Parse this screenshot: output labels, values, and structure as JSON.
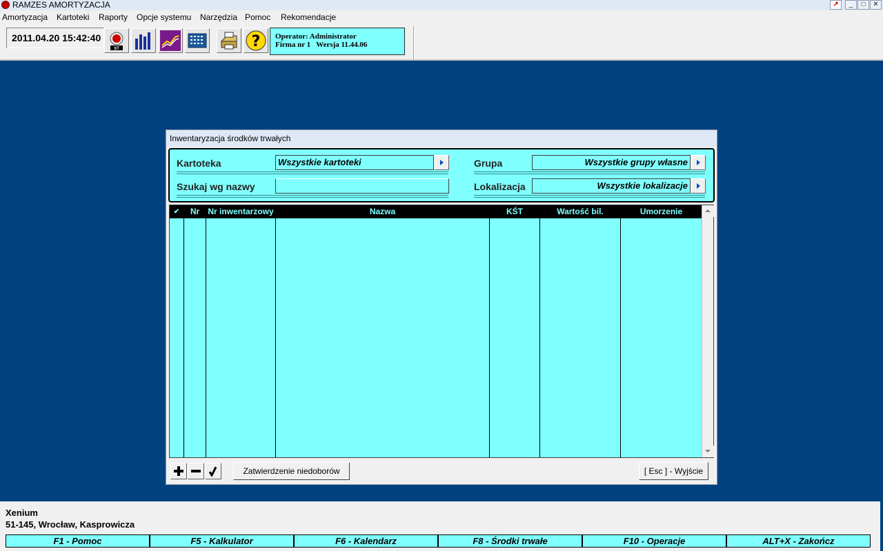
{
  "app": {
    "title": "RAMZES AMORTYZACJA"
  },
  "menu": [
    "Amortyzacja",
    "Kartoteki",
    "Raporty",
    "Opcje systemu",
    "Narzędzia",
    "Pomoc",
    "Rekomendacje"
  ],
  "toolbar": {
    "datetime": "2011.04.20 15:42:40",
    "operator_line1": "Operator: Administrator",
    "operator_line2": "Firma nr 1   Wersja 11.44.06",
    "st_label": "ST"
  },
  "dialog": {
    "title": "Inwentaryzacja środków trwałych",
    "filters": {
      "kartoteka_label": "Kartoteka",
      "kartoteka_value": "Wszystkie kartoteki",
      "szukaj_label": "Szukaj wg nazwy",
      "szukaj_value": "",
      "grupa_label": "Grupa",
      "grupa_value": "Wszystkie grupy własne",
      "lokalizacja_label": "Lokalizacja",
      "lokalizacja_value": "Wszystkie lokalizacje"
    },
    "grid": {
      "columns": [
        "✔",
        "Nr",
        "Nr inwentarzowy",
        "Nazwa",
        "KŚT",
        "Wartość bil.",
        "Umorzenie"
      ],
      "rows": []
    },
    "buttons": {
      "add": "+",
      "remove": "−",
      "confirm": "Zatwierdzenie niedoborów",
      "exit": "[ Esc ] - Wyjście"
    }
  },
  "footer": {
    "company_name": "Xenium",
    "company_address": "51-145, Wrocław, Kasprowicza",
    "fkeys": [
      "F1 - Pomoc",
      "F5 - Kalkulator",
      "F6 - Kalendarz",
      "F8 - Środki trwałe",
      "F10 - Operacje",
      "ALT+X - Zakończ"
    ]
  },
  "colors": {
    "desktop": "#00427f",
    "panel": "#80ffff",
    "header": "#000000"
  }
}
